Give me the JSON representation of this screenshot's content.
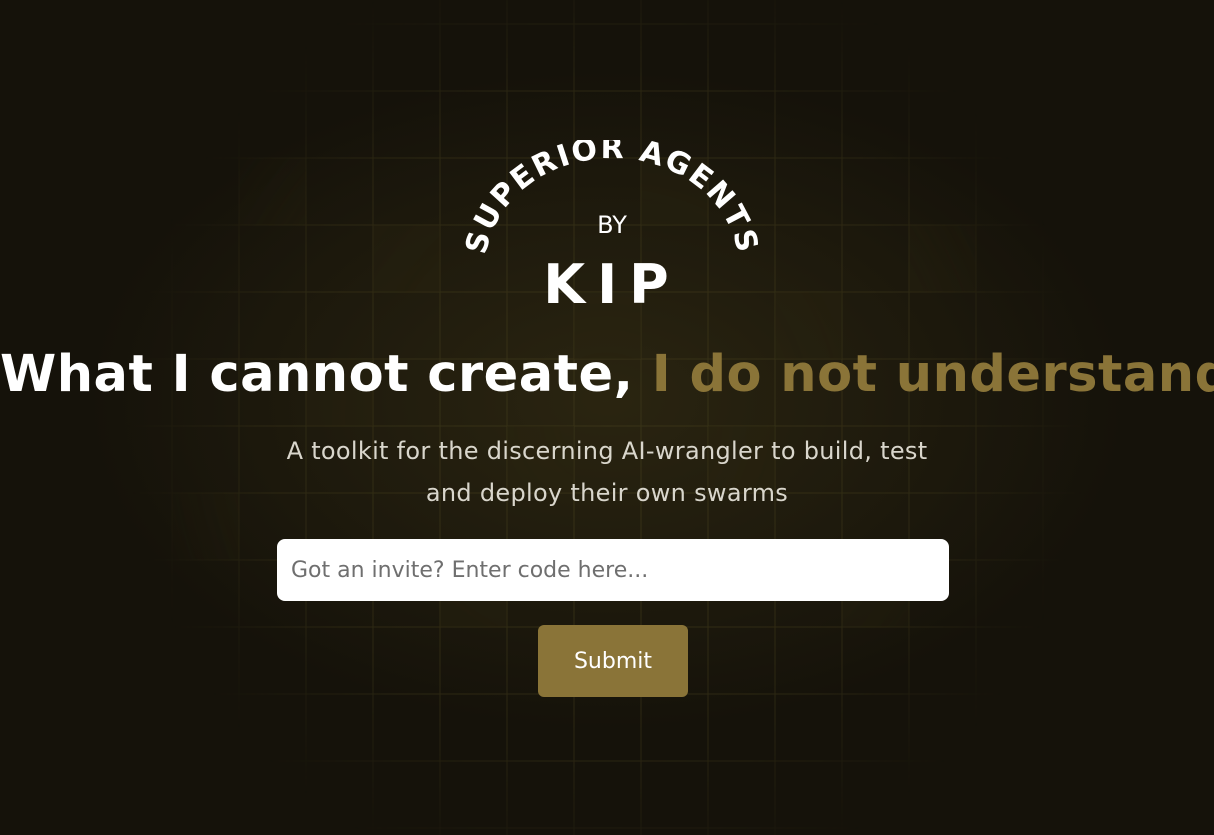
{
  "logo": {
    "arc_text": "SUPERIOR AGENTS",
    "by": "BY",
    "name": "KIP"
  },
  "hero": {
    "headline_white": "What I cannot create,",
    "headline_gold": "I do not understand",
    "subtitle": "A toolkit for the discerning AI-wrangler to build, test and deploy their own swarms"
  },
  "invite": {
    "placeholder": "Got an invite? Enter code here...",
    "value": ""
  },
  "submit": {
    "label": "Submit"
  },
  "colors": {
    "background": "#15120a",
    "accent": "#8a7438",
    "grid_line": "#3a3418"
  }
}
